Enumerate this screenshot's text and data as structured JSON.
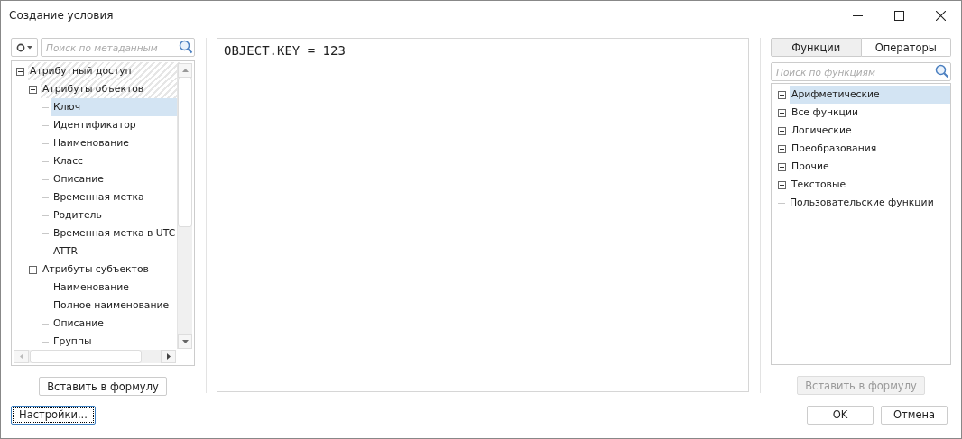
{
  "window": {
    "title": "Создание условия"
  },
  "metadata_panel": {
    "search": {
      "placeholder": "Поиск по метаданным"
    },
    "tree": [
      {
        "label": "Атрибутный доступ",
        "expanded": true,
        "in_path": true,
        "selected": false,
        "children": [
          {
            "label": "Атрибуты объектов",
            "expanded": true,
            "in_path": true,
            "selected": false,
            "children": [
              {
                "label": "Ключ",
                "selected": true
              },
              {
                "label": "Идентификатор",
                "selected": false
              },
              {
                "label": "Наименование",
                "selected": false
              },
              {
                "label": "Класс",
                "selected": false
              },
              {
                "label": "Описание",
                "selected": false
              },
              {
                "label": "Временная метка",
                "selected": false
              },
              {
                "label": "Родитель",
                "selected": false
              },
              {
                "label": "Временная метка в UTC",
                "selected": false
              },
              {
                "label": "ATTR",
                "selected": false
              }
            ]
          },
          {
            "label": "Атрибуты субъектов",
            "expanded": true,
            "in_path": false,
            "selected": false,
            "children": [
              {
                "label": "Наименование",
                "selected": false
              },
              {
                "label": "Полное наименование",
                "selected": false
              },
              {
                "label": "Описание",
                "selected": false
              },
              {
                "label": "Группы",
                "selected": false
              }
            ]
          }
        ]
      }
    ],
    "insert_button": {
      "label": "Вставить в формулу",
      "disabled": false
    }
  },
  "editor": {
    "value": "OBJECT.KEY = 123"
  },
  "functions_panel": {
    "tabs": [
      {
        "label": "Функции",
        "selected": true
      },
      {
        "label": "Операторы",
        "selected": false
      }
    ],
    "search": {
      "placeholder": "Поиск по функциям"
    },
    "tree": [
      {
        "label": "Арифметические",
        "expanded": false,
        "selected": true
      },
      {
        "label": "Все функции",
        "expanded": false,
        "selected": false
      },
      {
        "label": "Логические",
        "expanded": false,
        "selected": false
      },
      {
        "label": "Преобразования",
        "expanded": false,
        "selected": false
      },
      {
        "label": "Прочие",
        "expanded": false,
        "selected": false
      },
      {
        "label": "Текстовые",
        "expanded": false,
        "selected": false
      },
      {
        "label": "Пользовательские функции",
        "selected": false
      }
    ],
    "insert_button": {
      "label": "Вставить в формулу",
      "disabled": true
    }
  },
  "buttons": [
    {
      "label": "Настройки...",
      "kind": "settings"
    },
    {
      "label": "OK",
      "kind": "ok"
    },
    {
      "label": "Отмена",
      "kind": "cancel"
    }
  ]
}
